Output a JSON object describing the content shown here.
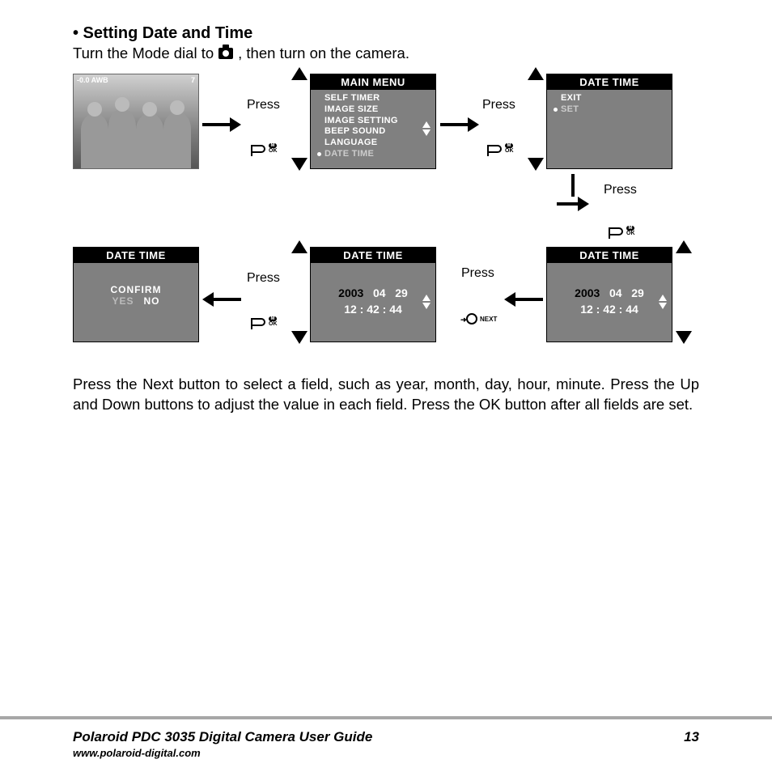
{
  "heading": "• Setting Date and Time",
  "intro_before": "Turn the Mode dial to ",
  "intro_after": ", then turn on the camera.",
  "press_label": "Press",
  "ok_label": "OK",
  "m_label": "M",
  "next_label": "NEXT",
  "photo_osd": {
    "left": "-0.0 AWB",
    "right": "7"
  },
  "screens": {
    "main_menu": {
      "title": "MAIN  MENU",
      "items": [
        "SELF TIMER",
        "IMAGE  SIZE",
        "IMAGE  SETTING",
        "BEEP  SOUND",
        "LANGUAGE",
        "DATE  TIME"
      ],
      "selected_index": 5
    },
    "datetime_menu": {
      "title": "DATE TIME",
      "items": [
        "EXIT",
        "SET"
      ],
      "selected_index": 1
    },
    "datetime_value": {
      "title": "DATE TIME",
      "year": "2003",
      "month": "04",
      "day": "29",
      "time": "12 : 42 : 44"
    },
    "confirm": {
      "title": "DATE TIME",
      "label": "CONFIRM",
      "yes": "YES",
      "no": "NO"
    }
  },
  "body_text": "Press the Next button to select a field, such as year, month, day, hour, minute. Press the Up and Down buttons to adjust the value in each field. Press the OK button after all fields are set.",
  "footer": {
    "guide": "Polaroid PDC 3035 Digital Camera User Guide",
    "page": "13",
    "url": "www.polaroid-digital.com"
  }
}
